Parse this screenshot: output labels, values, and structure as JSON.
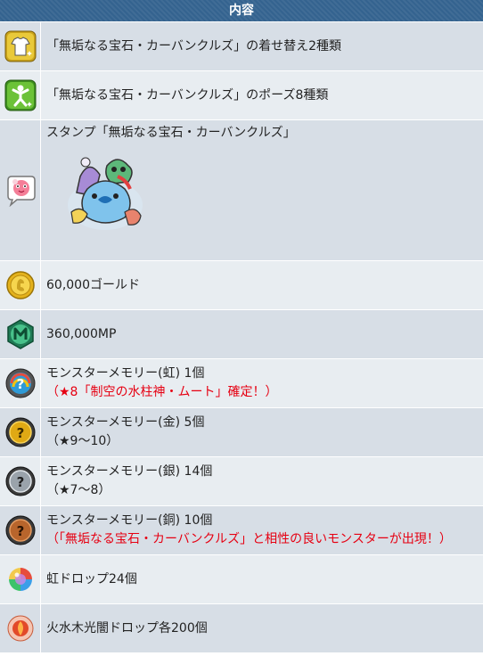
{
  "header": {
    "title": "内容"
  },
  "rows": [
    {
      "icon": "shirt-sparkle-icon",
      "lines": [
        "「無垢なる宝石・カーバンクルズ」の着せ替え2種類"
      ]
    },
    {
      "icon": "pose-figure-icon",
      "lines": [
        "「無垢なる宝石・カーバンクルズ」のポーズ8種類"
      ]
    },
    {
      "icon": "stamp-bubble-icon",
      "lines": [
        "スタンプ「無垢なる宝石・カーバンクルズ」"
      ],
      "image": "carbuncles-stamp-image"
    },
    {
      "icon": "gold-coin-icon",
      "lines": [
        "60,000ゴールド"
      ]
    },
    {
      "icon": "mp-orb-icon",
      "lines": [
        "360,000MP"
      ]
    },
    {
      "icon": "rainbow-memory-icon",
      "lines": [
        "モンスターメモリー(虹) 1個",
        "（★8「制空の水柱神・ムート」確定！）"
      ]
    },
    {
      "icon": "gold-memory-icon",
      "lines": [
        "モンスターメモリー(金) 5個",
        "（★9～10）"
      ]
    },
    {
      "icon": "silver-memory-icon",
      "lines": [
        "モンスターメモリー(銀) 14個",
        "（★7～8）"
      ]
    },
    {
      "icon": "bronze-memory-icon",
      "lines": [
        "モンスターメモリー(銅) 10個",
        "（「無垢なる宝石・カーバンクルズ」と相性の良いモンスターが出現！）"
      ]
    },
    {
      "icon": "rainbow-drop-icon",
      "lines": [
        "虹ドロップ24個"
      ]
    },
    {
      "icon": "element-drop-icon",
      "lines": [
        "火水木光闇ドロップ各200個"
      ]
    }
  ],
  "colors": {
    "header_bg": "#34638f",
    "row_odd": "#d7dee6",
    "row_even": "#e8edf1",
    "note_red": "#e60012"
  }
}
